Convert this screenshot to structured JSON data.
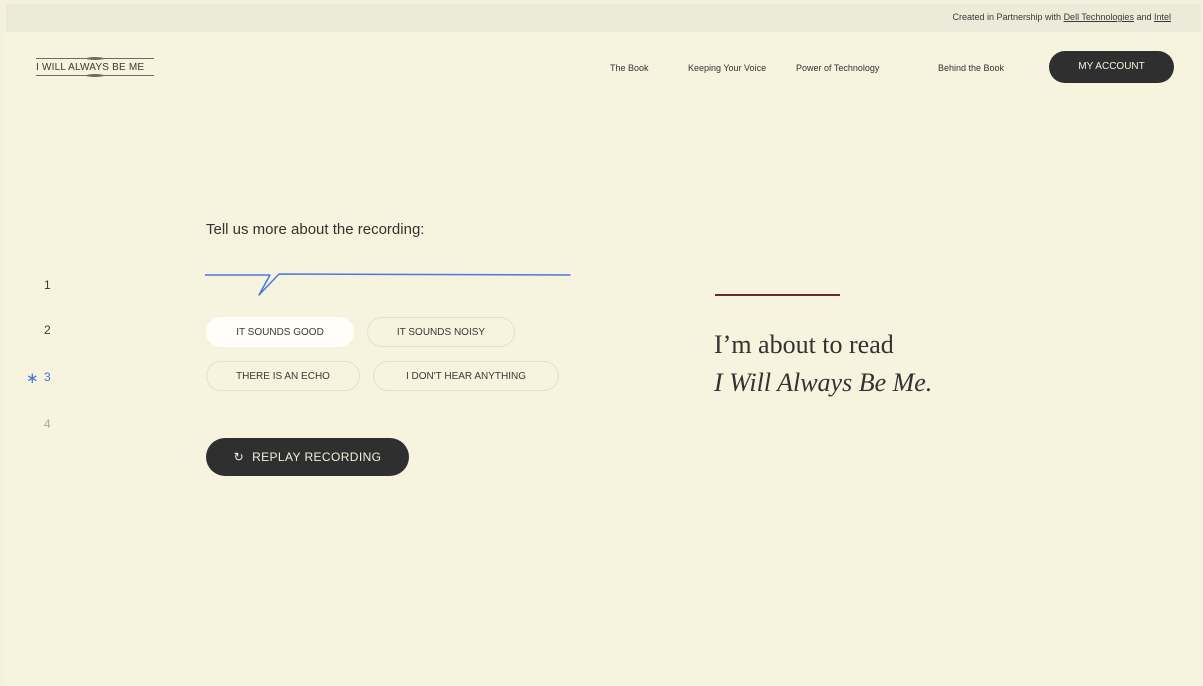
{
  "topbar": {
    "partner_prefix": "Created in Partnership with ",
    "partner_link_1": "Dell Technologies",
    "partner_mid": " and ",
    "partner_link_2": "Intel"
  },
  "header": {
    "logo_text": "I WILL ALWAYS BE ME",
    "nav": [
      {
        "label": "The Book"
      },
      {
        "label": "Keeping Your Voice"
      },
      {
        "label": "Power of Technology"
      },
      {
        "label": "Behind the Book"
      }
    ],
    "account_label": "MY ACCOUNT"
  },
  "steps": [
    {
      "label": "1",
      "state": "normal"
    },
    {
      "label": "2",
      "state": "normal"
    },
    {
      "label": "3",
      "state": "active"
    },
    {
      "label": "4",
      "state": "muted"
    }
  ],
  "step_indicator_icon": "asterisk-icon",
  "question": {
    "prompt": "Tell us more about the recording:",
    "options": [
      {
        "label": "IT SOUNDS GOOD",
        "selected": true
      },
      {
        "label": "IT SOUNDS NOISY",
        "selected": false
      },
      {
        "label": "THERE IS AN ECHO",
        "selected": false
      },
      {
        "label": "I DON'T HEAR ANYTHING",
        "selected": false
      }
    ],
    "replay_label": "REPLAY RECORDING",
    "replay_icon": "refresh-icon"
  },
  "reading": {
    "line1": "I’m about to read",
    "line2": "I Will Always Be Me."
  },
  "colors": {
    "background": "#f6f3df",
    "topbar": "#ecead9",
    "dark_button": "#2f2f30",
    "accent_blue": "#4472d8",
    "accent_rule": "#6d2a1f"
  }
}
